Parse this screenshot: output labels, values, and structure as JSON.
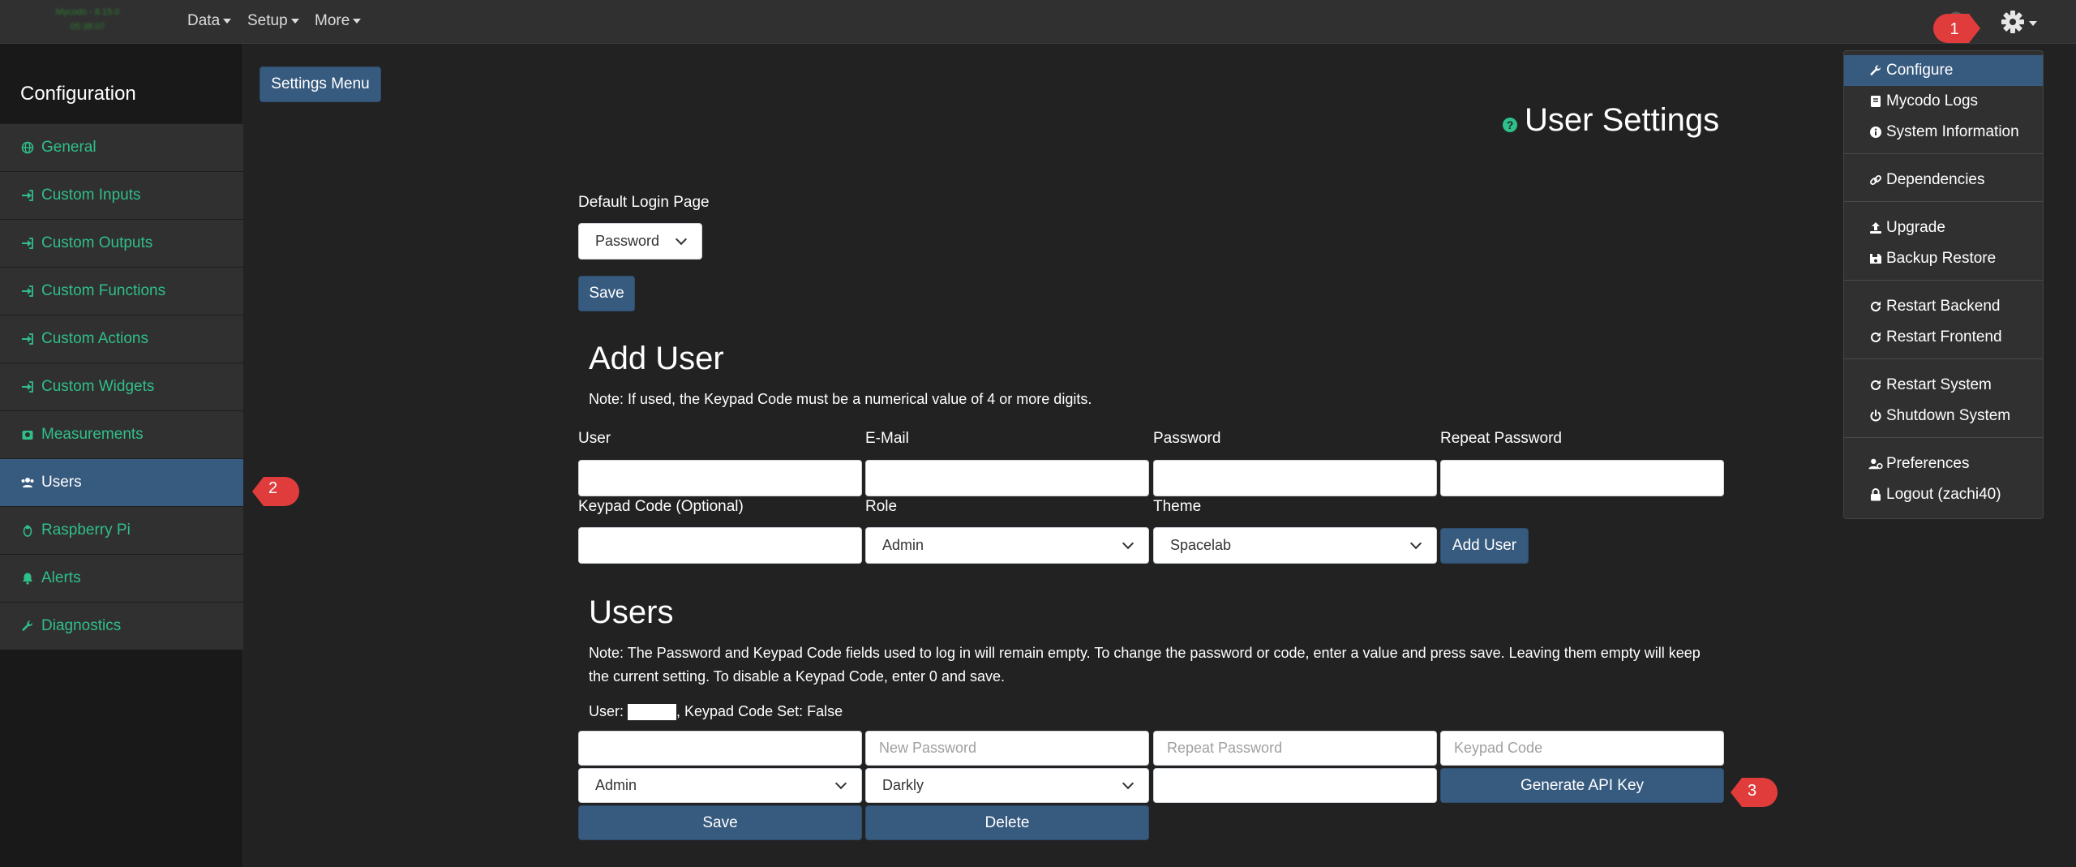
{
  "navbar": {
    "brand_line1": "Mycodo - 8.15.0",
    "brand_line2": "05:38:07",
    "menus": [
      "Data",
      "Setup",
      "More"
    ]
  },
  "sidebar": {
    "title": "Configuration",
    "items": [
      {
        "label": "General",
        "icon": "globe-icon"
      },
      {
        "label": "Custom Inputs",
        "icon": "sign-in-icon"
      },
      {
        "label": "Custom Outputs",
        "icon": "sign-in-icon"
      },
      {
        "label": "Custom Functions",
        "icon": "sign-in-icon"
      },
      {
        "label": "Custom Actions",
        "icon": "sign-in-icon"
      },
      {
        "label": "Custom Widgets",
        "icon": "sign-in-icon"
      },
      {
        "label": "Measurements",
        "icon": "weight-icon"
      },
      {
        "label": "Users",
        "icon": "users-icon",
        "active": true
      },
      {
        "label": "Raspberry Pi",
        "icon": "linux-icon"
      },
      {
        "label": "Alerts",
        "icon": "bell-icon"
      },
      {
        "label": "Diagnostics",
        "icon": "wrench-icon"
      }
    ]
  },
  "main": {
    "settings_menu_button": "Settings Menu",
    "page_title": "User Settings",
    "default_login": {
      "label": "Default Login Page",
      "value": "Password",
      "save": "Save"
    },
    "add_user": {
      "heading": "Add User",
      "note": "Note: If used, the Keypad Code must be a numerical value of 4 or more digits.",
      "labels": {
        "user": "User",
        "email": "E-Mail",
        "password": "Password",
        "repeat_password": "Repeat Password",
        "keypad": "Keypad Code (Optional)",
        "role": "Role",
        "theme": "Theme"
      },
      "role_value": "Admin",
      "theme_value": "Spacelab",
      "button": "Add User"
    },
    "users": {
      "heading": "Users",
      "note": "Note: The Password and Keypad Code fields used to log in will remain empty. To change the password or code, enter a value and press save. Leaving them empty will keep the current setting. To disable a Keypad Code, enter 0 and save.",
      "user_prefix": "User: ",
      "user_suffix": ", Keypad Code Set: False",
      "new_password_placeholder": "New Password",
      "repeat_password_placeholder": "Repeat Password",
      "keypad_placeholder": "Keypad Code",
      "role_value": "Admin",
      "theme_value": "Darkly",
      "generate_api": "Generate API Key",
      "save": "Save",
      "delete": "Delete"
    }
  },
  "dropdown": {
    "items": [
      {
        "label": "Configure",
        "icon": "wrench-icon"
      },
      {
        "label": "Mycodo Logs",
        "icon": "book-icon"
      },
      {
        "label": "System Information",
        "icon": "info-circle-icon"
      },
      {
        "label": "Dependencies",
        "icon": "link-icon"
      },
      {
        "label": "Upgrade",
        "icon": "upload-icon"
      },
      {
        "label": "Backup Restore",
        "icon": "floppy-icon"
      },
      {
        "label": "Restart Backend",
        "icon": "redo-icon"
      },
      {
        "label": "Restart Frontend",
        "icon": "redo-icon"
      },
      {
        "label": "Restart System",
        "icon": "redo-icon"
      },
      {
        "label": "Shutdown System",
        "icon": "power-icon"
      },
      {
        "label": "Preferences",
        "icon": "user-cog-icon"
      },
      {
        "label": "Logout (zachi40)",
        "icon": "lock-icon"
      }
    ]
  },
  "callouts": [
    "1",
    "2",
    "3"
  ],
  "colors": {
    "accent": "#375a7f",
    "sidebar_link": "#2fbf8a",
    "callout": "#e03c3c"
  }
}
